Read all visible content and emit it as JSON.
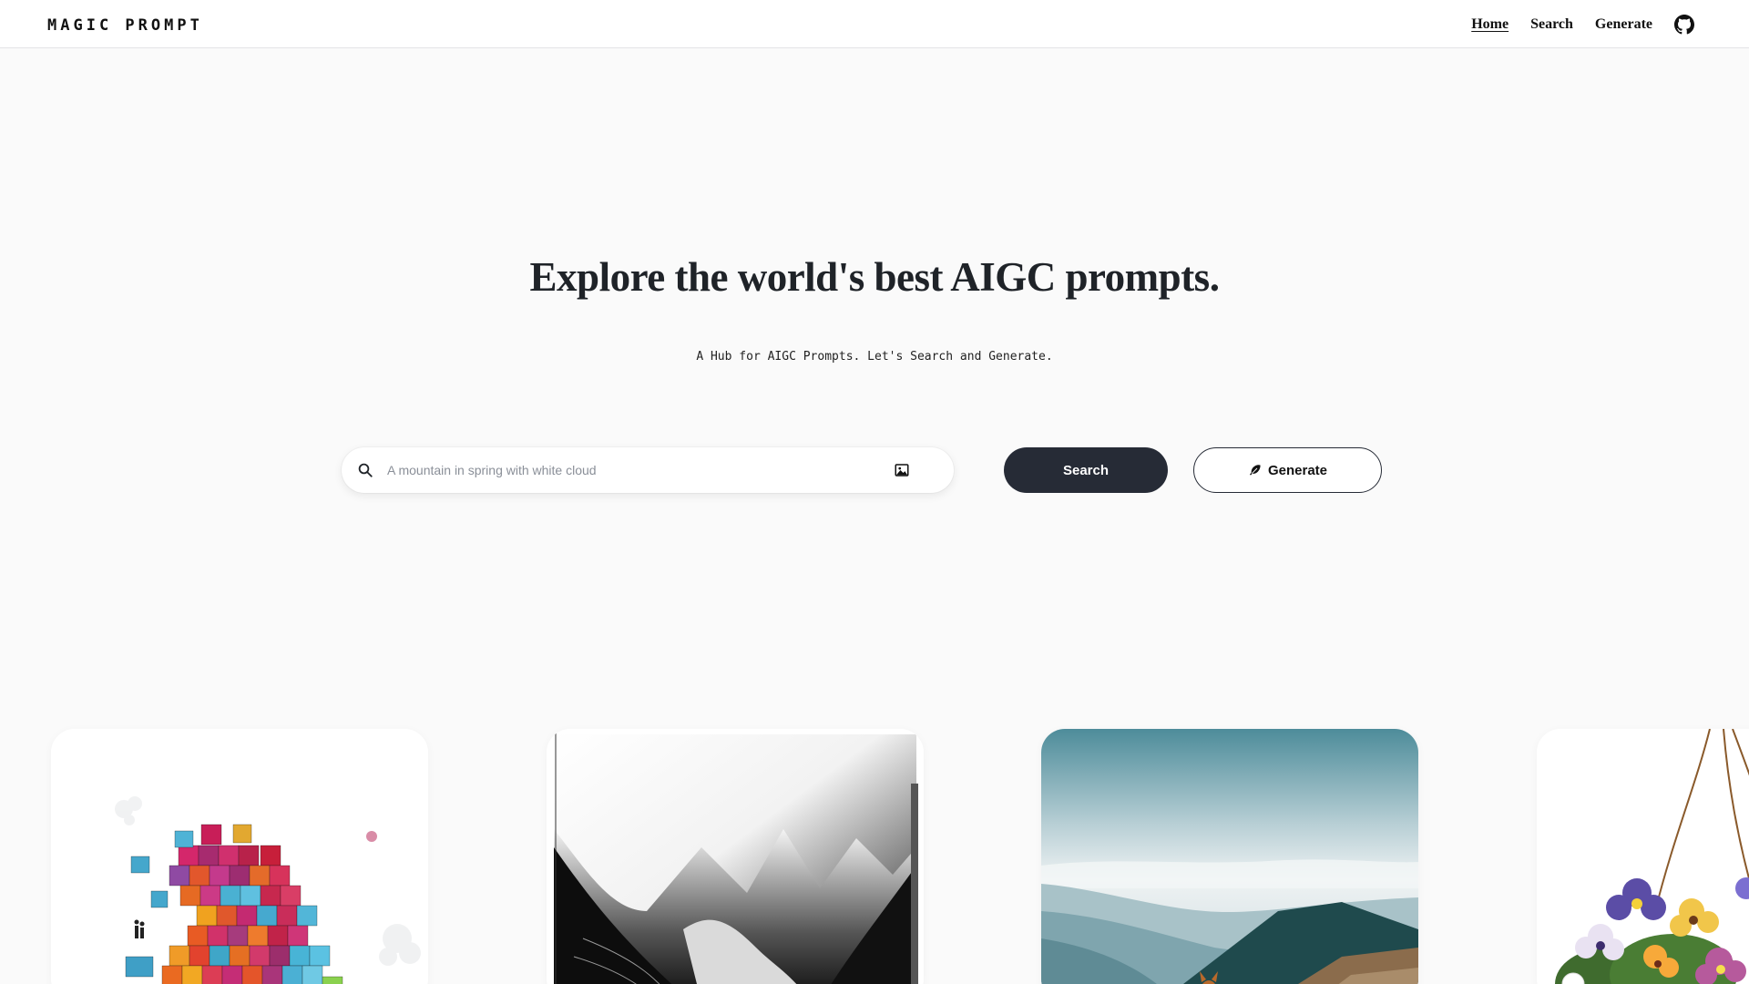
{
  "header": {
    "logo": "MAGIC PROMPT",
    "nav": [
      {
        "label": "Home",
        "active": true
      },
      {
        "label": "Search",
        "active": false
      },
      {
        "label": "Generate",
        "active": false
      }
    ],
    "github_icon": "github-icon"
  },
  "hero": {
    "title": "Explore the world's best AIGC prompts.",
    "subtitle": "A Hub for AIGC Prompts. Let's Search and Generate."
  },
  "search": {
    "placeholder": "A mountain in spring with white cloud",
    "value": "",
    "search_icon": "search-icon",
    "image_icon": "image-upload-icon"
  },
  "buttons": {
    "search_label": "Search",
    "generate_label": "Generate",
    "generate_icon": "feather-icon"
  },
  "gallery": [
    {
      "name": "colorful-cubes-image"
    },
    {
      "name": "monochrome-mountains-image"
    },
    {
      "name": "misty-valley-image"
    },
    {
      "name": "hanging-flowers-image"
    }
  ],
  "colors": {
    "background": "#fafafa",
    "primary_button": "#262b36",
    "text": "#1f2328"
  }
}
